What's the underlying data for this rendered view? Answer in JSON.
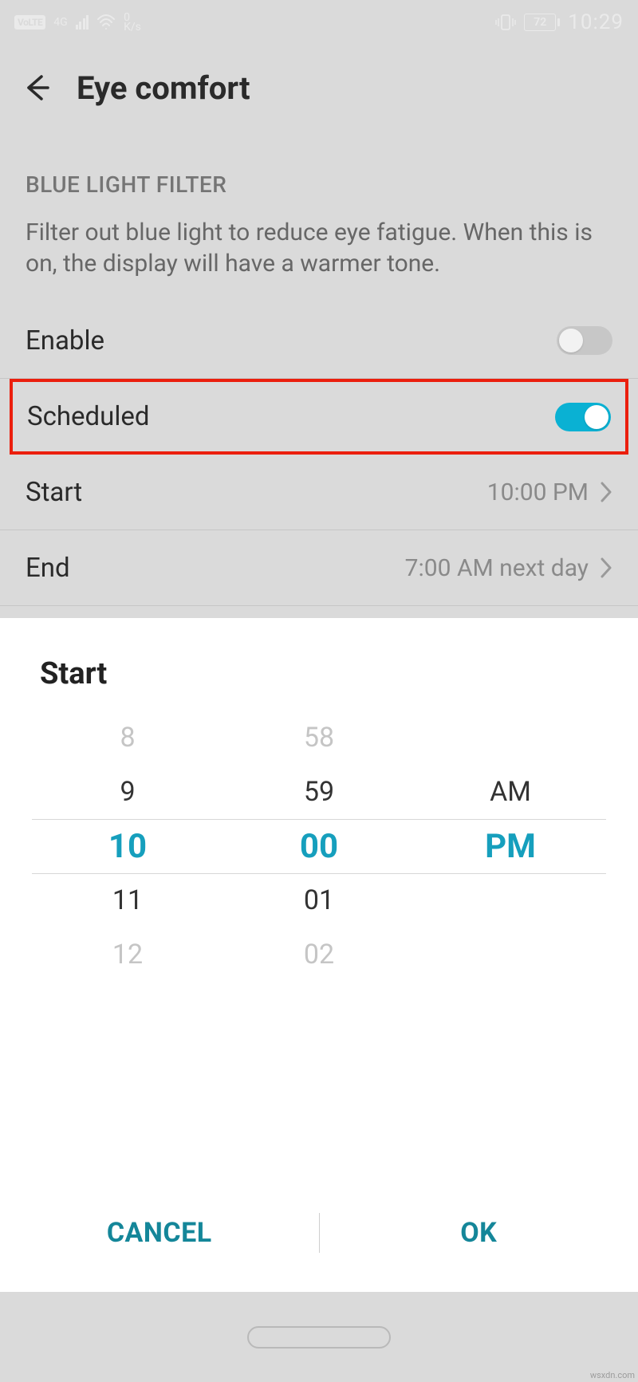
{
  "statusbar": {
    "volte": "VoLTE",
    "netgen": "4G",
    "speed_top": "0",
    "speed_bot": "K/s",
    "battery": "72",
    "time": "10:29"
  },
  "header": {
    "title": "Eye comfort"
  },
  "section": {
    "label": "BLUE LIGHT FILTER",
    "description": "Filter out blue light to reduce eye fatigue. When this is on, the display will have a warmer tone."
  },
  "rows": {
    "enable": {
      "label": "Enable",
      "on": false
    },
    "scheduled": {
      "label": "Scheduled",
      "on": true
    },
    "start": {
      "label": "Start",
      "value": "10:00 PM"
    },
    "end": {
      "label": "End",
      "value": "7:00 AM next day"
    }
  },
  "picker": {
    "title": "Start",
    "hour": {
      "m2": "8",
      "m1": "9",
      "sel": "10",
      "p1": "11",
      "p2": "12"
    },
    "minute": {
      "m2": "58",
      "m1": "59",
      "sel": "00",
      "p1": "01",
      "p2": "02"
    },
    "ampm": {
      "m1": "AM",
      "sel": "PM"
    },
    "cancel": "CANCEL",
    "ok": "OK"
  },
  "watermark": "wsxdn.com"
}
